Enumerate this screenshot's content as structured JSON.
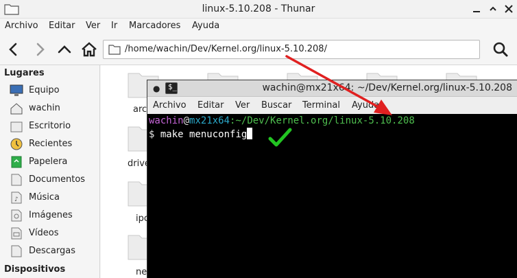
{
  "thunar": {
    "title": "linux-5.10.208 - Thunar",
    "menu": [
      "Archivo",
      "Editar",
      "Ver",
      "Ir",
      "Marcadores",
      "Ayuda"
    ],
    "location": "/home/wachin/Dev/Kernel.org/linux-5.10.208/",
    "sidebar": {
      "places_header": "Lugares",
      "places": [
        {
          "label": "Equipo",
          "icon": "computer-icon"
        },
        {
          "label": "wachin",
          "icon": "home-folder-icon"
        },
        {
          "label": "Escritorio",
          "icon": "desktop-folder-icon"
        },
        {
          "label": "Recientes",
          "icon": "recent-clock-icon"
        },
        {
          "label": "Papelera",
          "icon": "trash-icon"
        },
        {
          "label": "Documentos",
          "icon": "documents-folder-icon"
        },
        {
          "label": "Música",
          "icon": "music-folder-icon"
        },
        {
          "label": "Imágenes",
          "icon": "pictures-folder-icon"
        },
        {
          "label": "Vídeos",
          "icon": "videos-folder-icon"
        },
        {
          "label": "Descargas",
          "icon": "downloads-folder-icon"
        }
      ],
      "devices_header": "Dispositivos"
    },
    "files_visible_labels": [
      "arc",
      "drive",
      "ipc",
      "ne"
    ]
  },
  "terminal": {
    "title": "wachin@mx21x64: ~/Dev/Kernel.org/linux-5.10.208",
    "icon_glyph": "$_",
    "menu": [
      "Archivo",
      "Editar",
      "Ver",
      "Buscar",
      "Terminal",
      "Ayuda"
    ],
    "prompt": {
      "user": "wachin",
      "at": "@",
      "host": "mx21x64",
      "path": ":~/Dev/Kernel.org/linux-5.10.208",
      "symbol": "$",
      "command": "make menuconfig"
    }
  },
  "colors": {
    "prompt_user": "#c464d6",
    "prompt_host": "#2aa8c9",
    "prompt_path": "#4fbf4f",
    "arrow": "#e02020",
    "checkmark": "#22c422"
  }
}
